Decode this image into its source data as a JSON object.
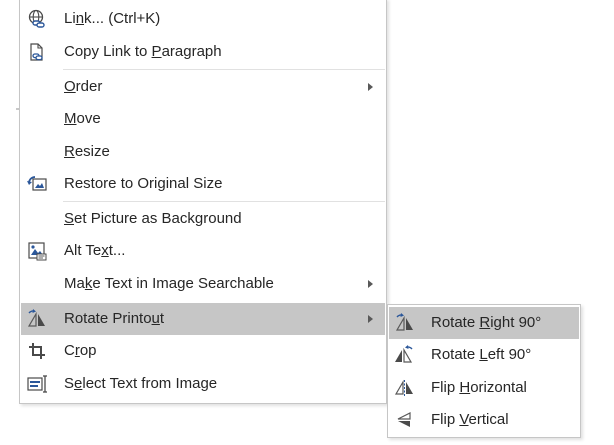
{
  "menu": {
    "items": [
      {
        "pre": "",
        "acc": "",
        "post": "",
        "label": "Link...  (Ctrl+K)",
        "parts": [
          "Li",
          "n",
          "k...  (Ctrl+K)"
        ],
        "icon": "link-globe-icon"
      },
      {
        "label": "Copy Link to Paragraph",
        "parts": [
          "Copy Link to ",
          "P",
          "aragraph"
        ],
        "icon": "copy-link-document-icon"
      },
      {
        "label": "Order",
        "parts": [
          "",
          "O",
          "rder"
        ],
        "submenu": true
      },
      {
        "label": "Move",
        "parts": [
          "",
          "M",
          "ove"
        ]
      },
      {
        "label": "Resize",
        "parts": [
          "",
          "R",
          "esize"
        ]
      },
      {
        "label": "Restore to Original Size",
        "parts": [
          "Restore to Ori",
          "g",
          "inal Size"
        ],
        "icon": "restore-size-icon"
      },
      {
        "label": "Set Picture as Background",
        "parts": [
          "",
          "S",
          "et Picture as Background"
        ]
      },
      {
        "label": "Alt Text...",
        "parts": [
          "Alt Te",
          "x",
          "t..."
        ],
        "icon": "alt-text-icon"
      },
      {
        "label": "Make Text in Image Searchable",
        "parts": [
          "Ma",
          "k",
          "e Text in Image Searchable"
        ],
        "submenu": true
      },
      {
        "label": "Rotate Printout",
        "parts": [
          "Rotate Printo",
          "u",
          "t"
        ],
        "icon": "rotate-printout-icon",
        "submenu": true,
        "highlight": true
      },
      {
        "label": "Crop",
        "parts": [
          "C",
          "r",
          "op"
        ],
        "icon": "crop-icon"
      },
      {
        "label": "Select Text from Image",
        "parts": [
          "S",
          "e",
          "lect Text from Image"
        ],
        "icon": "select-text-image-icon"
      }
    ]
  },
  "submenu": {
    "items": [
      {
        "label": "Rotate Right 90°",
        "parts": [
          "Rotate ",
          "R",
          "ight 90°"
        ],
        "icon": "rotate-right-icon",
        "highlight": true
      },
      {
        "label": "Rotate Left 90°",
        "parts": [
          "Rotate ",
          "L",
          "eft 90°"
        ],
        "icon": "rotate-left-icon"
      },
      {
        "label": "Flip Horizontal",
        "parts": [
          "Flip ",
          "H",
          "orizontal"
        ],
        "icon": "flip-horizontal-icon"
      },
      {
        "label": "Flip Vertical",
        "parts": [
          "Flip ",
          "V",
          "ertical"
        ],
        "icon": "flip-vertical-icon"
      }
    ]
  },
  "colors": {
    "highlight": "#c6c6c6",
    "icon_blue": "#2b579a",
    "icon_gray": "#595959"
  }
}
